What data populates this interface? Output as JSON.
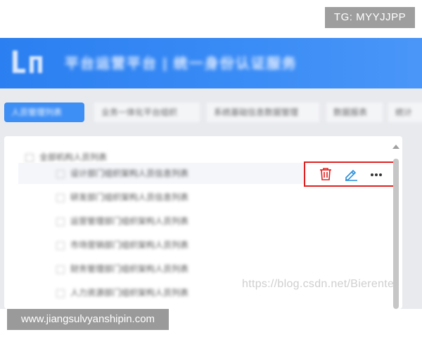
{
  "overlay_tag": "TG: MYYJJPP",
  "header": {
    "title": "平台运营平台 | 统一身份认证服务"
  },
  "tabs": [
    {
      "label": "人员管理列表"
    },
    {
      "label": "业务一体化平台组织"
    },
    {
      "label": "系统基础信息数据管理"
    },
    {
      "label": "数据报表"
    },
    {
      "label": "统计"
    }
  ],
  "tree": {
    "root": "全部机构人员列表",
    "items": [
      {
        "label": "设计部门组织架构人员信息列表"
      },
      {
        "label": "研发部门组织架构人员信息列表"
      },
      {
        "label": "运营管理部门组织架构人员列表"
      },
      {
        "label": "市场营销部门组织架构人员列表"
      },
      {
        "label": "财务管理部门组织架构人员列表"
      },
      {
        "label": "人力资源部门组织架构人员列表"
      }
    ]
  },
  "actions": {
    "delete_icon": "trash-icon",
    "edit_icon": "pencil-icon",
    "more_icon": "ellipsis-icon",
    "delete_color": "#e02020",
    "edit_color": "#2a8fd8"
  },
  "watermark": "https://blog.csdn.net/Bierente",
  "footer_tag": "www.jiangsulvyanshipin.com"
}
